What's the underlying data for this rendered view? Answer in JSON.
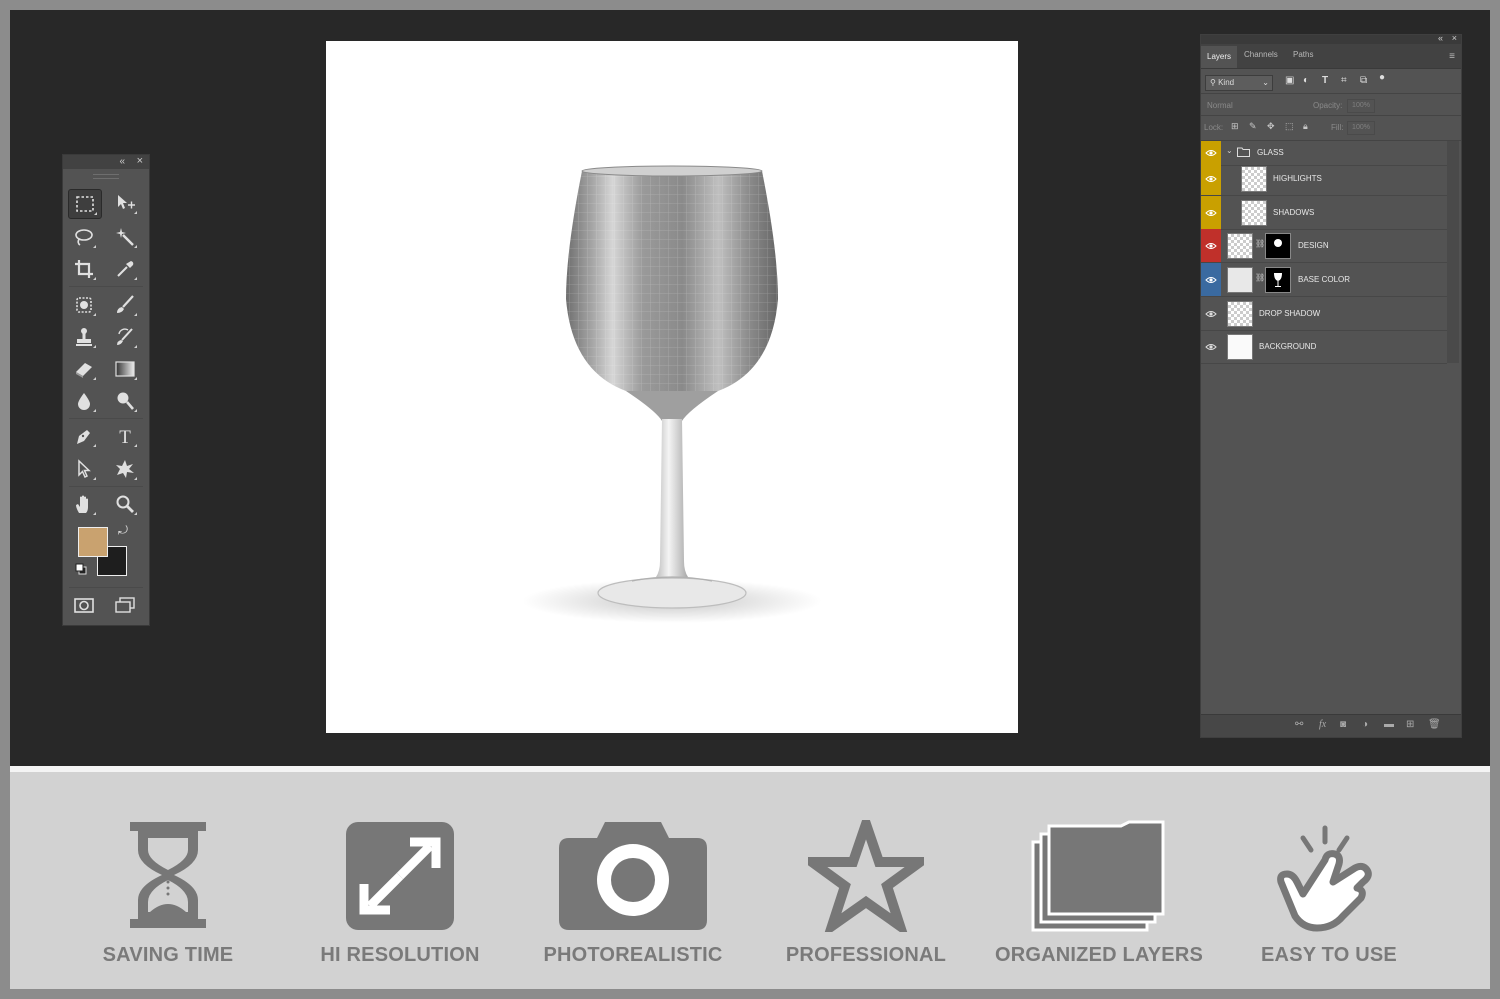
{
  "toolbox": {
    "collapse_glyph": "«",
    "close_glyph": "×",
    "tools": [
      {
        "name": "rectangular-marquee-tool",
        "icon": "rect-marquee-icon"
      },
      {
        "name": "move-tool",
        "icon": "move-icon"
      },
      {
        "name": "lasso-tool",
        "icon": "lasso-icon"
      },
      {
        "name": "magic-wand-tool",
        "icon": "magic-wand-icon"
      },
      {
        "name": "crop-tool",
        "icon": "crop-icon"
      },
      {
        "name": "eyedropper-tool",
        "icon": "eyedropper-icon"
      },
      {
        "name": "spot-healing-tool",
        "icon": "healing-icon"
      },
      {
        "name": "brush-tool",
        "icon": "brush-icon"
      },
      {
        "name": "clone-stamp-tool",
        "icon": "stamp-icon"
      },
      {
        "name": "history-brush-tool",
        "icon": "history-brush-icon"
      },
      {
        "name": "eraser-tool",
        "icon": "eraser-icon"
      },
      {
        "name": "gradient-tool",
        "icon": "gradient-icon"
      },
      {
        "name": "blur-tool",
        "icon": "blur-icon"
      },
      {
        "name": "dodge-tool",
        "icon": "dodge-icon"
      },
      {
        "name": "pen-tool",
        "icon": "pen-icon"
      },
      {
        "name": "type-tool",
        "icon": "type-icon"
      },
      {
        "name": "path-selection-tool",
        "icon": "path-selection-icon"
      },
      {
        "name": "custom-shape-tool",
        "icon": "custom-shape-icon"
      },
      {
        "name": "hand-tool",
        "icon": "hand-icon"
      },
      {
        "name": "zoom-tool",
        "icon": "zoom-icon"
      }
    ],
    "foreground_color": "#c9a26f",
    "background_color": "#1e1e1e"
  },
  "layers_panel": {
    "tabs": [
      "Layers",
      "Channels",
      "Paths"
    ],
    "active_tab": "Layers",
    "filter_kind": "Kind",
    "blend_mode": "Normal",
    "opacity_label": "Opacity:",
    "opacity_value": "100%",
    "lock_label": "Lock:",
    "fill_label": "Fill:",
    "fill_value": "100%",
    "layers": [
      {
        "name": "GLASS",
        "type": "group",
        "tag_color": "#c9a000"
      },
      {
        "name": "HIGHLIGHTS",
        "type": "layer",
        "tag_color": "#c9a000"
      },
      {
        "name": "SHADOWS",
        "type": "layer",
        "tag_color": "#c9a000"
      },
      {
        "name": "DESIGN",
        "type": "smart-masked",
        "tag_color": "#c0302a"
      },
      {
        "name": "BASE COLOR",
        "type": "masked",
        "tag_color": "#3a6aa0"
      },
      {
        "name": "DROP SHADOW",
        "type": "layer",
        "tag_color": ""
      },
      {
        "name": "BACKGROUND",
        "type": "layer",
        "tag_color": ""
      }
    ]
  },
  "features": [
    {
      "label": "SAVING TIME",
      "icon": "hourglass-icon"
    },
    {
      "label": "HI RESOLUTION",
      "icon": "expand-arrows-icon"
    },
    {
      "label": "PHOTOREALISTIC",
      "icon": "camera-icon"
    },
    {
      "label": "PROFESSIONAL",
      "icon": "star-icon"
    },
    {
      "label": "ORGANIZED LAYERS",
      "icon": "stacked-folders-icon"
    },
    {
      "label": "EASY TO USE",
      "icon": "tap-hand-icon"
    }
  ],
  "colors": {
    "workspace": "#282828",
    "panel": "#535353",
    "feature_strip": "#d2d2d2",
    "feature_icon": "#777777"
  }
}
